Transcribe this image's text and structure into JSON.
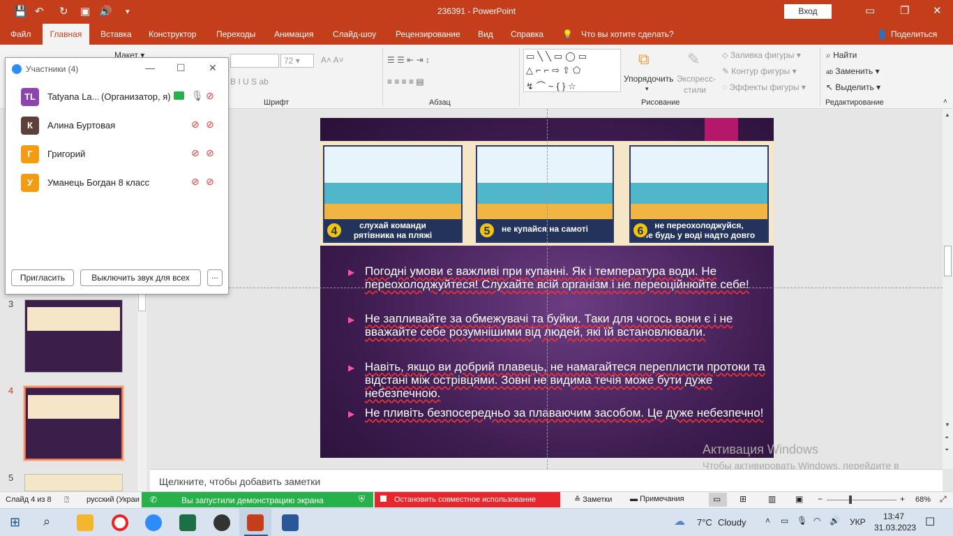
{
  "titlebar": {
    "title": "236391  -  PowerPoint",
    "signin_label": "Вход"
  },
  "menu": {
    "tabs": [
      "Файл",
      "Главная",
      "Вставка",
      "Конструктор",
      "Переходы",
      "Анимация",
      "Слайд-шоу",
      "Рецензирование",
      "Вид",
      "Справка"
    ],
    "search_placeholder": "Что вы хотите сделать?",
    "share_label": "Поделиться"
  },
  "ribbon": {
    "layout_label": "Макет",
    "font_size": "72",
    "group_font": "Шрифт",
    "group_paragraph": "Абзац",
    "group_drawing": "Рисование",
    "group_editing": "Редактирование",
    "arrange_label": "Упорядочить",
    "express_styles_label_1": "Экспресс-",
    "express_styles_label_2": "стили",
    "fill_label": "Заливка фигуры",
    "outline_label": "Контур фигуры",
    "effects_label": "Эффекты фигуры",
    "find_label": "Найти",
    "replace_label": "Заменить",
    "select_label": "Выделить"
  },
  "participants": {
    "title": "Участники (4)",
    "people": [
      {
        "initials": "TL",
        "name": "Tatyana La...",
        "role": "(Организатор, я)",
        "color": "#8e44ad"
      },
      {
        "initials": "К",
        "name": "Алина Буртовая",
        "role": "",
        "color": "#5d4037"
      },
      {
        "initials": "Г",
        "name": "Григорий",
        "role": "",
        "color": "#f39c12"
      },
      {
        "initials": "У",
        "name": "Уманець Богдан 8 класс",
        "role": "",
        "color": "#f39c12"
      }
    ],
    "invite_label": "Пригласить",
    "mute_all_label": "Выключить звук для всех",
    "more_label": "..."
  },
  "thumbnails": {
    "numbers": [
      "3",
      "4",
      "5"
    ]
  },
  "slide": {
    "captions": [
      {
        "num": "4",
        "text1": "слухай команди",
        "text2": "рятівника на пляжі"
      },
      {
        "num": "5",
        "text1": "не купайся на самоті",
        "text2": ""
      },
      {
        "num": "6",
        "text1": "не переохолоджуйся,",
        "text2": "не будь у воді надто довго"
      }
    ],
    "bullets": [
      "Погодні умови є важливі при купанні. Як і температура води.  Не переохолоджуйтеся! Слухайте всій організм і не переоційнюйте себе!",
      "Не запливайте за обмежувачі та буйки. Таки для чогось вони є і не вважайте себе розумнішими від людей, які їй встановлювали.",
      "Навіть, якщо ви добрий плавець, не намагайтеся переплисти протоки та відстані між острівцями. Зовні не видима течія може бути дуже небезпечною.",
      " Не пливіть безпосередньо за плаваючим засобом. Це дуже небезпечно!"
    ]
  },
  "notes": {
    "placeholder": "Щелкните, чтобы добавить заметки"
  },
  "activation": {
    "title": "Активация Windows",
    "subtitle": "Чтобы активировать Windows, перейдите в раздел \"Параметры\"."
  },
  "statusbar": {
    "slide_info": "Слайд 4 из 8",
    "language": "русский (Украи",
    "screen_share_text": "Вы запустили демонстрацию экрана",
    "stop_share_text": "Остановить совместное использование",
    "notes_label": "Заметки",
    "comments_label": "Примечания",
    "zoom_level": "68%"
  },
  "taskbar": {
    "weather_temp": "7°C",
    "weather_desc": "Cloudy",
    "lang": "УКР",
    "time": "13:47",
    "date": "31.03.2023"
  },
  "colors": {
    "accent": "#c43e1c",
    "zoom_green": "#27b14a",
    "zoom_red": "#e8262b"
  }
}
